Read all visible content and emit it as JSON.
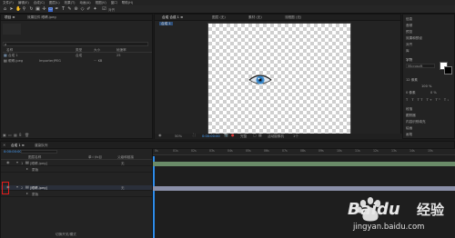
{
  "menubar": [
    "文件(F)",
    "编辑(E)",
    "合成(C)",
    "图层(L)",
    "效果(T)",
    "动画(A)",
    "视图(V)",
    "窗口",
    "帮助(H)"
  ],
  "toolbar": {
    "snap_label": "对齐"
  },
  "project": {
    "tab_label": "项目 ≡",
    "effects_tab": "效果控件 眼睛.jpeg",
    "search_placeholder": "ρ",
    "columns": [
      "名称",
      "类型",
      "大小",
      "帧速率"
    ],
    "items": [
      {
        "name": "合成 1",
        "type": "合成",
        "size": "",
        "fps": "25"
      },
      {
        "name": "眼睛.jpeg",
        "type": "ImporterJPEG",
        "size": "··· KB",
        "fps": ""
      }
    ]
  },
  "comp": {
    "tabs": [
      "合成 合成 1 ≡",
      "图层 (无)",
      "素材 (无)",
      "流程图 (无)"
    ],
    "breadcrumb": "合成 1",
    "bottom": {
      "zoom": "50%",
      "timecode": "0:00:00:00",
      "quality": "完整",
      "view": "活动摄像机",
      "views": "1个"
    }
  },
  "rightpanel": {
    "items": [
      "信息",
      "音频",
      "预览",
      "效果和预设",
      "对齐",
      "库",
      "字符",
      "段落",
      "跟踪器",
      "内容识别填充",
      "绘画",
      "画笔"
    ],
    "font": "Microsoft",
    "sizes": [
      "12 像素",
      "100 %",
      "0 %",
      "0 像素"
    ],
    "swatch_fg": "#ffffff",
    "swatch_bg": "#000000"
  },
  "timeline": {
    "tab_label": "合成 1 ≡",
    "render_tab": "渲染队列",
    "timecode": "0:00:00:00",
    "columns": [
      "图层名称",
      "单☆\\fx目",
      "父级和链接"
    ],
    "layers": [
      {
        "num": "1",
        "name": "[眼睛.jpeg]",
        "parent": "无",
        "sub": "蒙版"
      },
      {
        "num": "2",
        "name": "[眼睛.jpeg]",
        "parent": "无",
        "sub": "蒙版"
      }
    ],
    "ruler": [
      "0s",
      "01s",
      "02s",
      "03s",
      "04s",
      "05s",
      "06s",
      "07s",
      "08s",
      "09s",
      "10s",
      "11s",
      "12s",
      "13s",
      "14s",
      "15s"
    ],
    "bottom_label": "切换开关/模式"
  },
  "watermark": {
    "brand": "Baidu",
    "cn": "经验",
    "url": "jingyan.baidu.com"
  },
  "colors": {
    "accent_blue": "#2d8ceb",
    "track_green": "#6a8b68",
    "track_selected": "#8a8fa8",
    "highlight_red": "#e01b1b"
  }
}
